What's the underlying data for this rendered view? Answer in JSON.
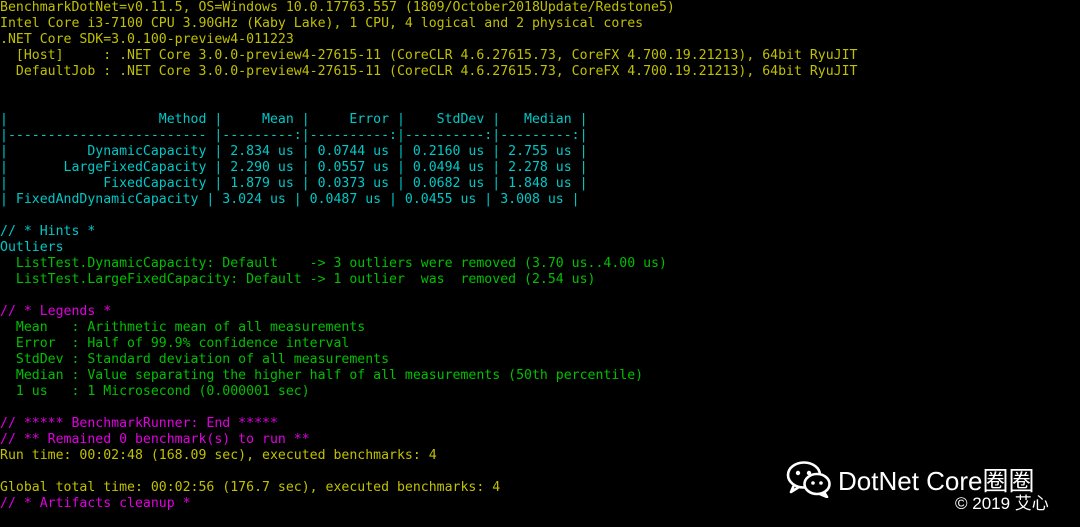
{
  "console": {
    "header": [
      "BenchmarkDotNet=v0.11.5, OS=Windows 10.0.17763.557 (1809/October2018Update/Redstone5)",
      "Intel Core i3-7100 CPU 3.90GHz (Kaby Lake), 1 CPU, 4 logical and 2 physical cores",
      ".NET Core SDK=3.0.100-preview4-011223",
      "  [Host]     : .NET Core 3.0.0-preview4-27615-11 (CoreCLR 4.6.27615.73, CoreFX 4.700.19.21213), 64bit RyuJIT",
      "  DefaultJob : .NET Core 3.0.0-preview4-27615-11 (CoreCLR 4.6.27615.73, CoreFX 4.700.19.21213), 64bit RyuJIT"
    ],
    "table": {
      "header_line": "|                   Method |     Mean |     Error |    StdDev |   Median |",
      "separator_line": "|------------------------- |---------:|----------:|----------:|---------:|",
      "rows": [
        "|          DynamicCapacity | 2.834 us | 0.0744 us | 0.2160 us | 2.755 us |",
        "|       LargeFixedCapacity | 2.290 us | 0.0557 us | 0.0494 us | 2.278 us |",
        "|            FixedCapacity | 1.879 us | 0.0373 us | 0.0682 us | 1.848 us |",
        "| FixedAndDynamicCapacity | 3.024 us | 0.0487 us | 0.0455 us | 3.008 us |"
      ],
      "columns": [
        "Method",
        "Mean",
        "Error",
        "StdDev",
        "Median"
      ],
      "data": [
        [
          "DynamicCapacity",
          "2.834 us",
          "0.0744 us",
          "0.2160 us",
          "2.755 us"
        ],
        [
          "LargeFixedCapacity",
          "2.290 us",
          "0.0557 us",
          "0.0494 us",
          "2.278 us"
        ],
        [
          "FixedCapacity",
          "1.879 us",
          "0.0373 us",
          "0.0682 us",
          "1.848 us"
        ],
        [
          "FixedAndDynamicCapacity",
          "3.024 us",
          "0.0487 us",
          "0.0455 us",
          "3.008 us"
        ]
      ]
    },
    "hints": {
      "title": "// * Hints *",
      "subtitle": "Outliers",
      "lines": [
        "  ListTest.DynamicCapacity: Default    -> 3 outliers were removed (3.70 us..4.00 us)",
        "  ListTest.LargeFixedCapacity: Default -> 1 outlier  was  removed (2.54 us)"
      ]
    },
    "legends": {
      "title": "// * Legends *",
      "lines": [
        "  Mean   : Arithmetic mean of all measurements",
        "  Error  : Half of 99.9% confidence interval",
        "  StdDev : Standard deviation of all measurements",
        "  Median : Value separating the higher half of all measurements (50th percentile)",
        "  1 us   : 1 Microsecond (0.000001 sec)"
      ]
    },
    "footer": {
      "runner_end": "// ***** BenchmarkRunner: End *****",
      "remained": "// ** Remained 0 benchmark(s) to run **",
      "run_time": "Run time: 00:02:48 (168.09 sec), executed benchmarks: 4",
      "global_total": "Global total time: 00:02:56 (176.7 sec), executed benchmarks: 4",
      "artifacts": "// * Artifacts cleanup *"
    }
  },
  "watermark": {
    "text": "DotNet Core圈圈",
    "copyright": "© 2019 艾心",
    "icon": "wechat-icon"
  },
  "colors": {
    "background": "#000000",
    "header": "#c0c000",
    "table": "#00c8c8",
    "hints": "#00c000",
    "legends_title": "#e000e0",
    "footer": "#e000e0",
    "plain": "#c8c8c8"
  }
}
